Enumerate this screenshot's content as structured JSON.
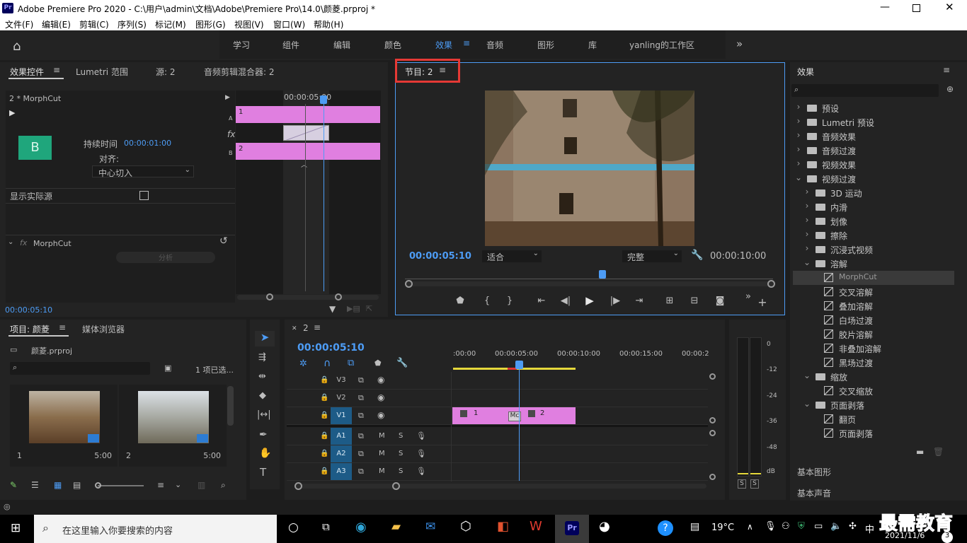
{
  "app": {
    "title": "Adobe Premiere Pro 2020 - C:\\用户\\admin\\文档\\Adobe\\Premiere Pro\\14.0\\颜菱.prproj *",
    "logo": "Pr"
  },
  "menu": [
    "文件(F)",
    "编辑(E)",
    "剪辑(C)",
    "序列(S)",
    "标记(M)",
    "图形(G)",
    "视图(V)",
    "窗口(W)",
    "帮助(H)"
  ],
  "workspaces": [
    "学习",
    "组件",
    "编辑",
    "颜色",
    "效果",
    "音频",
    "图形",
    "库",
    "yanling的工作区"
  ],
  "workspace_active": "效果",
  "effect_controls": {
    "tabs": [
      "效果控件",
      "Lumetri 范围",
      "源: 2",
      "音频剪辑混合器: 2"
    ],
    "clip": "2 * MorphCut",
    "thumb_letter": "B",
    "duration_label": "持续时间",
    "duration": "00:00:01:00",
    "align_label": "对齐:",
    "align_value": "中心切入",
    "show_source": "显示实际源",
    "fx_name": "MorphCut",
    "analyze": "分析",
    "mini_time": "00:00:05:00",
    "track_a_clip": "1",
    "track_b_clip": "2",
    "a": "A",
    "b": "B",
    "fx": "fx",
    "timecode": "00:00:05:10"
  },
  "program": {
    "tab": "节目: 2",
    "timecode": "00:00:05:10",
    "fit": "适合",
    "quality": "完整",
    "duration": "00:00:10:00"
  },
  "effects_panel": {
    "title": "效果",
    "items": [
      {
        "label": "预设",
        "level": 0,
        "type": "folder",
        "open": false
      },
      {
        "label": "Lumetri 预设",
        "level": 0,
        "type": "folder",
        "open": false
      },
      {
        "label": "音频效果",
        "level": 0,
        "type": "folder",
        "open": false
      },
      {
        "label": "音频过渡",
        "level": 0,
        "type": "folder",
        "open": false
      },
      {
        "label": "视频效果",
        "level": 0,
        "type": "folder",
        "open": false
      },
      {
        "label": "视频过渡",
        "level": 0,
        "type": "folder",
        "open": true
      },
      {
        "label": "3D 运动",
        "level": 1,
        "type": "folder",
        "open": false
      },
      {
        "label": "内滑",
        "level": 1,
        "type": "folder",
        "open": false
      },
      {
        "label": "划像",
        "level": 1,
        "type": "folder",
        "open": false
      },
      {
        "label": "擦除",
        "level": 1,
        "type": "folder",
        "open": false
      },
      {
        "label": "沉浸式视频",
        "level": 1,
        "type": "folder",
        "open": false
      },
      {
        "label": "溶解",
        "level": 1,
        "type": "folder",
        "open": true
      },
      {
        "label": "MorphCut",
        "level": 2,
        "type": "fx",
        "selected": true
      },
      {
        "label": "交叉溶解",
        "level": 2,
        "type": "fx"
      },
      {
        "label": "叠加溶解",
        "level": 2,
        "type": "fx"
      },
      {
        "label": "白场过渡",
        "level": 2,
        "type": "fx"
      },
      {
        "label": "胶片溶解",
        "level": 2,
        "type": "fx"
      },
      {
        "label": "非叠加溶解",
        "level": 2,
        "type": "fx"
      },
      {
        "label": "黑场过渡",
        "level": 2,
        "type": "fx"
      },
      {
        "label": "缩放",
        "level": 1,
        "type": "folder",
        "open": true
      },
      {
        "label": "交叉缩放",
        "level": 2,
        "type": "fx"
      },
      {
        "label": "页面剥落",
        "level": 1,
        "type": "folder",
        "open": true
      },
      {
        "label": "翻页",
        "level": 2,
        "type": "fx"
      },
      {
        "label": "页面剥落",
        "level": 2,
        "type": "fx"
      }
    ],
    "basic_graphics": "基本图形",
    "basic_sound": "基本声音"
  },
  "project": {
    "tabs": [
      "项目: 颜菱",
      "媒体浏览器"
    ],
    "file": "颜菱.prproj",
    "selected_count": "1 项已选...",
    "clips": [
      {
        "name": "1",
        "duration": "5:00"
      },
      {
        "name": "2",
        "duration": "5:00"
      }
    ]
  },
  "timeline": {
    "seq": "2",
    "timecode": "00:00:05:10",
    "ruler": [
      ":00:00",
      "00:00:05:00",
      "00:00:10:00",
      "00:00:15:00",
      "00:00:2"
    ],
    "video_tracks": [
      "V3",
      "V2",
      "V1"
    ],
    "audio_tracks": [
      "A1",
      "A2",
      "A3"
    ],
    "m": "M",
    "s": "S",
    "clip1": "1",
    "clip2": "2",
    "transition": "Mc"
  },
  "meter": {
    "scale": [
      "0",
      "-12",
      "-24",
      "-36",
      "-48",
      "dB"
    ],
    "solo": [
      "S",
      "S"
    ]
  },
  "taskbar": {
    "search_placeholder": "在这里输入你要搜索的内容",
    "temp": "19°C",
    "ime": "中",
    "date": "2021/11/6",
    "watermark": "最需教育",
    "notif": "3"
  }
}
